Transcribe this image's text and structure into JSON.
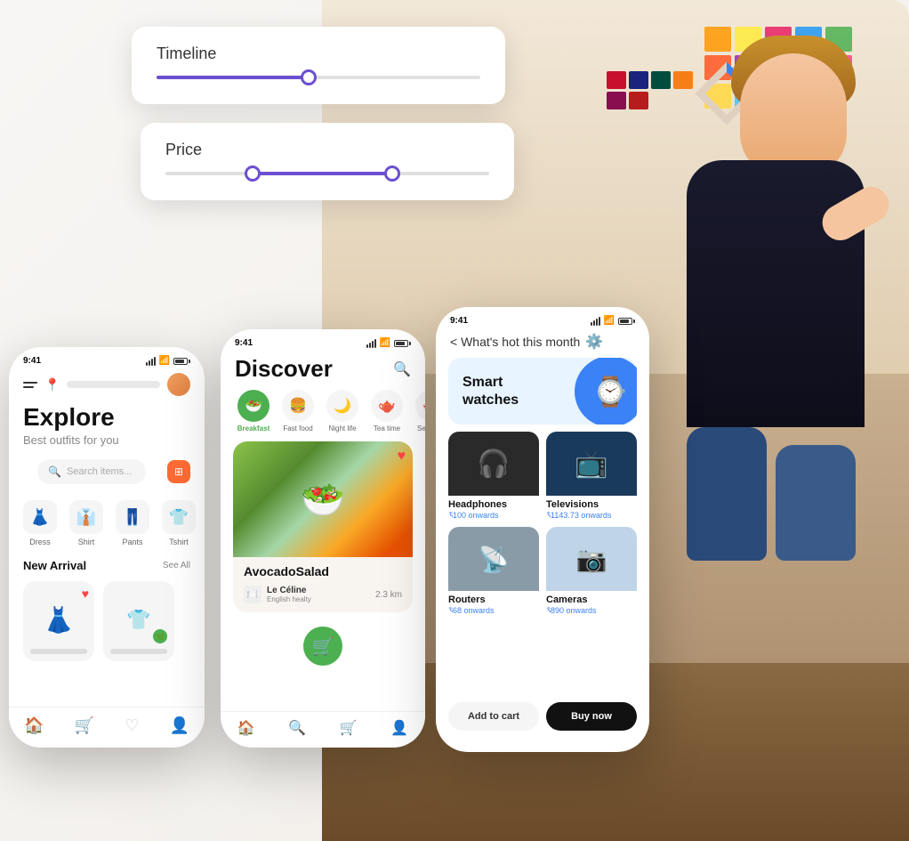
{
  "sliders": {
    "timeline_label": "Timeline",
    "price_label": "Price"
  },
  "phone1": {
    "time": "9:41",
    "title": "Explore",
    "subtitle": "Best outfits for you",
    "search_placeholder": "Search items...",
    "categories": [
      {
        "icon": "👗",
        "label": "Dress"
      },
      {
        "icon": "👔",
        "label": "Shirt"
      },
      {
        "icon": "👖",
        "label": "Pants"
      },
      {
        "icon": "👕",
        "label": "Tshirt"
      }
    ],
    "new_arrival_label": "New Arrival",
    "see_all_label": "See All",
    "nav_items": [
      "🏠",
      "🛒",
      "♡",
      "👤"
    ]
  },
  "phone2": {
    "time": "9:41",
    "title": "Discover",
    "categories": [
      {
        "icon": "🥗",
        "label": "Breakfast",
        "active": true
      },
      {
        "icon": "🍔",
        "label": "Fast food",
        "active": false
      },
      {
        "icon": "🌙",
        "label": "Night life",
        "active": false
      },
      {
        "icon": "🫖",
        "label": "Tea time",
        "active": false
      },
      {
        "icon": "🍣",
        "label": "Sea food",
        "active": false
      }
    ],
    "card_title": "AvocadoSalad",
    "restaurant_name": "Le Céline",
    "restaurant_sub": "English healty",
    "distance": "2.3 km",
    "nav_items": [
      "🏠",
      "🔍",
      "🛒",
      "👤"
    ]
  },
  "phone3": {
    "time": "9:41",
    "back_label": "< What's hot this month",
    "banner_title": "Smart\nwatches",
    "products": [
      {
        "label": "Headphones",
        "price": "$100 onwards",
        "emoji": "🎧",
        "bg": "dark"
      },
      {
        "label": "Televisions",
        "price": "$1143.73 onwards",
        "emoji": "📺",
        "bg": "blue"
      },
      {
        "label": "Routers",
        "price": "$68 onwards",
        "emoji": "📡",
        "bg": "gray"
      },
      {
        "label": "Cameras",
        "price": "$890 onwards",
        "emoji": "📷",
        "bg": "light"
      }
    ],
    "add_to_cart_label": "Add to cart",
    "buy_now_label": "Buy now"
  },
  "colors": {
    "purple": "#6c4fcf",
    "orange": "#ff6b35",
    "green": "#4caf50",
    "blue": "#3b82f6",
    "dark": "#111111"
  }
}
